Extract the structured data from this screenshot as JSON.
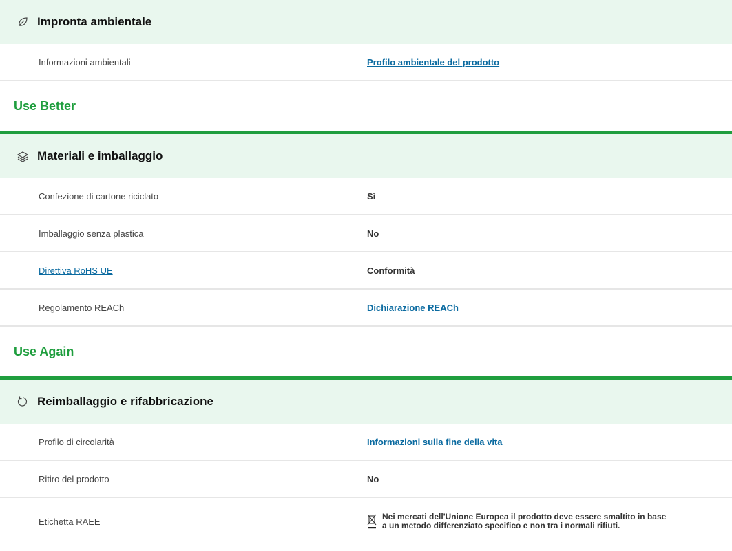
{
  "sections": [
    {
      "header": "",
      "band": {
        "icon": "leaf-icon",
        "title": "Impronta ambientale"
      },
      "rows": [
        {
          "label": "Informazioni ambientali",
          "value": "Profilo ambientale del prodotto"
        }
      ]
    },
    {
      "header": "Use Better",
      "band": {
        "icon": "layers-icon",
        "title": "Materiali e imballaggio"
      },
      "rows": [
        {
          "label": "Confezione di cartone riciclato",
          "value": "Sì"
        },
        {
          "label": "Imballaggio senza plastica",
          "value": "No"
        },
        {
          "label": "Direttiva RoHS UE",
          "value": "Conformità"
        },
        {
          "label": "Regolamento REACh",
          "value": "Dichiarazione REACh"
        }
      ]
    },
    {
      "header": "Use Again",
      "band": {
        "icon": "refresh-icon",
        "title": "Reimballaggio e rifabbricazione"
      },
      "rows": [
        {
          "label": "Profilo di circolarità",
          "value": "Informazioni sulla fine della vita"
        },
        {
          "label": "Ritiro del prodotto",
          "value": "No"
        },
        {
          "label": "Etichetta RAEE",
          "value": "Nei mercati dell'Unione Europea il prodotto deve essere smaltito in base a un metodo differenziato specifico e non tra i normali rifiuti.",
          "icon": "weee-bin-icon"
        }
      ]
    }
  ],
  "colors": {
    "accent": "#1f9e3e",
    "band_bg": "#e9f7ee",
    "link": "#0a6aa0"
  }
}
